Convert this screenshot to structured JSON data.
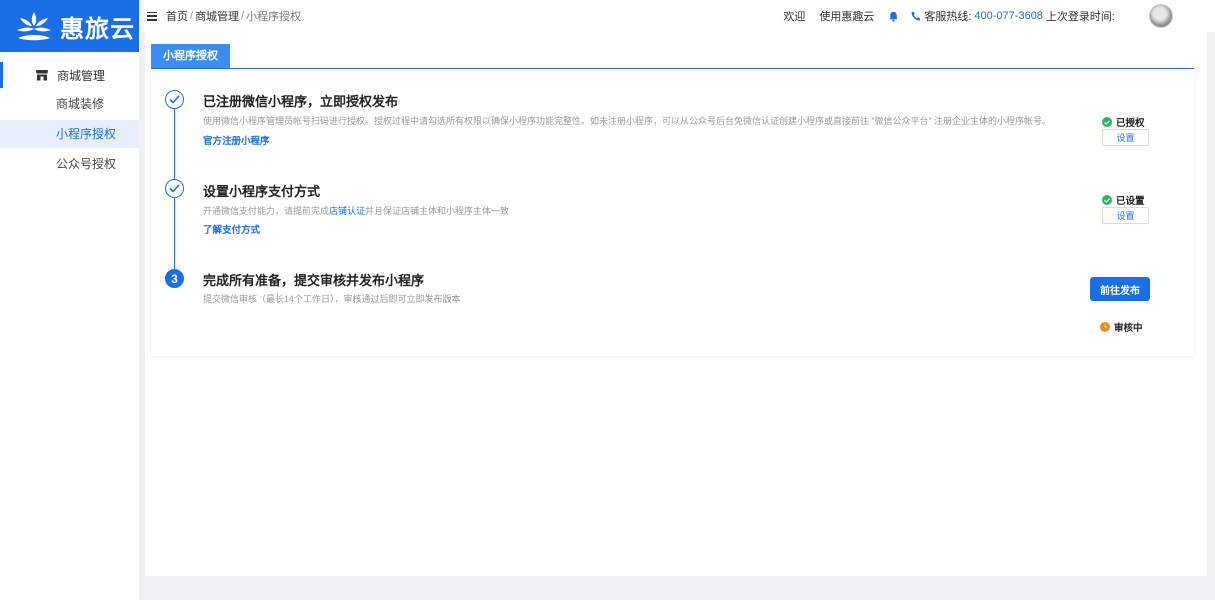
{
  "app": {
    "name": "惠旅云"
  },
  "sidebar": {
    "group_label": "商城管理",
    "items": [
      {
        "label": "商城装修",
        "active": false
      },
      {
        "label": "小程序授权",
        "active": true
      },
      {
        "label": "公众号授权",
        "active": false
      }
    ]
  },
  "header": {
    "breadcrumb": {
      "home": "首页",
      "section": "商城管理",
      "current": "小程序授权",
      "sep": "/"
    },
    "welcome": "欢迎",
    "using": "使用惠趣云",
    "hotline_label": "客服热线:",
    "hotline_number": "400-077-3608",
    "last_login_label": "上次登录时间:"
  },
  "tabs": [
    {
      "label": "小程序授权",
      "active": true
    }
  ],
  "steps": [
    {
      "title": "已注册微信小程序，立即授权发布",
      "desc": "使用微信小程序管理员帐号扫码进行授权。授权过程中请勾选所有权限以确保小程序功能完整性。如未注册小程序，可以从公众号后台免微信认证创建小程序或直接前往 “微信公众平台” 注册企业主体的小程序帐号。",
      "link": "官方注册小程序",
      "status": "已授权",
      "action": "设置"
    },
    {
      "title": "设置小程序支付方式",
      "desc_before": "开通微信支付能力，请提前完成",
      "desc_link": "店铺认证",
      "desc_after": "并且保证店铺主体和小程序主体一致",
      "link": "了解支付方式",
      "status": "已设置",
      "action": "设置"
    },
    {
      "number": "3",
      "title": "完成所有准备，提交审核并发布小程序",
      "desc": "提交微信审核（最长14个工作日），审核通过后即可立即发布版本",
      "action": "前往发布",
      "status": "审核中"
    }
  ],
  "colors": {
    "primary": "#1a6fe8",
    "success": "#28b463",
    "pending": "#f08c1a"
  }
}
